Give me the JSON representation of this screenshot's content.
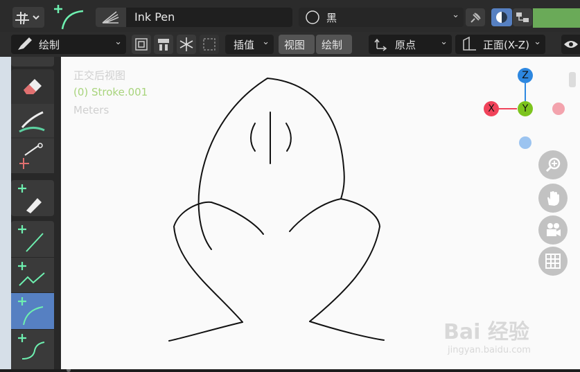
{
  "header": {
    "brush_name": "Ink Pen",
    "material_name": "黑"
  },
  "toolbar2": {
    "mode_label": "绘制",
    "interpolate_label": "插值",
    "view_menu": "视图",
    "draw_menu": "绘制",
    "origin_label": "原点",
    "view_axis_label": "正面(X-Z)"
  },
  "viewport": {
    "view_name": "正交后视图",
    "object_label": "(0) Stroke.001",
    "units": "Meters"
  },
  "gizmo": {
    "z": "Z",
    "x": "X",
    "y": "Y"
  },
  "watermark": {
    "logo": "Bai 经验",
    "url": "jingyan.baidu.com"
  },
  "colors": {
    "accent": "#5680c2",
    "object_text": "#a8d47c",
    "axis_x": "#f0435a",
    "axis_y": "#7dc41e",
    "axis_z": "#2d87e0"
  },
  "icons": [
    "stroke-placement-icon",
    "curve-add-icon",
    "brush-icon",
    "material-sphere-icon",
    "pin-icon",
    "eraser-icon",
    "tint-icon",
    "cutter-icon",
    "eyedropper-icon",
    "line-icon",
    "polyline-icon",
    "arc-icon",
    "curve-icon",
    "zoom-icon",
    "hand-icon",
    "camera-icon",
    "grid-icon"
  ]
}
